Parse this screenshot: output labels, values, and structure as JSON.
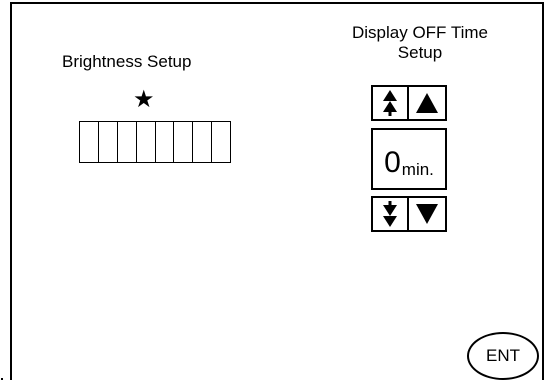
{
  "brightness": {
    "title": "Brightness Setup",
    "marker_icon": "star-icon",
    "segments": 8
  },
  "display_off": {
    "title_line1": "Display OFF Time",
    "title_line2": "Setup",
    "value": "0",
    "unit": "min.",
    "buttons": {
      "fast_up_icon": "double-up-arrow-icon",
      "up_icon": "up-triangle-icon",
      "fast_down_icon": "double-down-arrow-icon",
      "down_icon": "down-triangle-icon"
    }
  },
  "enter_button": {
    "label": "ENT"
  }
}
